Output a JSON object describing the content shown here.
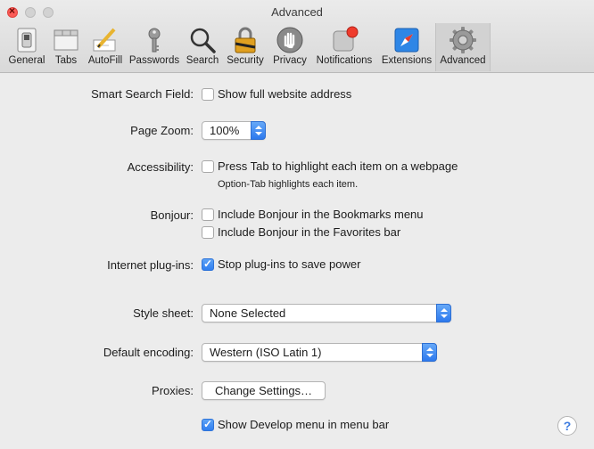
{
  "window": {
    "title": "Advanced"
  },
  "toolbar": {
    "tabs": [
      {
        "label": "General",
        "icon": "switch-icon"
      },
      {
        "label": "Tabs",
        "icon": "tabs-icon"
      },
      {
        "label": "AutoFill",
        "icon": "pencil-form-icon"
      },
      {
        "label": "Passwords",
        "icon": "key-icon"
      },
      {
        "label": "Search",
        "icon": "magnifier-icon"
      },
      {
        "label": "Security",
        "icon": "padlock-icon"
      },
      {
        "label": "Privacy",
        "icon": "hand-icon"
      },
      {
        "label": "Notifications",
        "icon": "notification-icon"
      },
      {
        "label": "Extensions",
        "icon": "compass-icon"
      },
      {
        "label": "Advanced",
        "icon": "gear-icon"
      }
    ],
    "active": "Advanced"
  },
  "settings": {
    "smart_search": {
      "label": "Smart Search Field:",
      "option": "Show full website address",
      "checked": false
    },
    "page_zoom": {
      "label": "Page Zoom:",
      "value": "100%"
    },
    "accessibility": {
      "label": "Accessibility:",
      "option": "Press Tab to highlight each item on a webpage",
      "hint": "Option-Tab highlights each item.",
      "checked": false
    },
    "bonjour": {
      "label": "Bonjour:",
      "option1": "Include Bonjour in the Bookmarks menu",
      "option2": "Include Bonjour in the Favorites bar"
    },
    "plugins": {
      "label": "Internet plug-ins:",
      "option": "Stop plug-ins to save power",
      "checked": true
    },
    "style_sheet": {
      "label": "Style sheet:",
      "value": "None Selected"
    },
    "encoding": {
      "label": "Default encoding:",
      "value": "Western (ISO Latin 1)"
    },
    "proxies": {
      "label": "Proxies:",
      "button": "Change Settings…"
    },
    "develop": {
      "option": "Show Develop menu in menu bar",
      "checked": true
    }
  },
  "help": {
    "glyph": "?"
  },
  "colors": {
    "accent": "#2f7ef0",
    "background": "#ececec"
  }
}
